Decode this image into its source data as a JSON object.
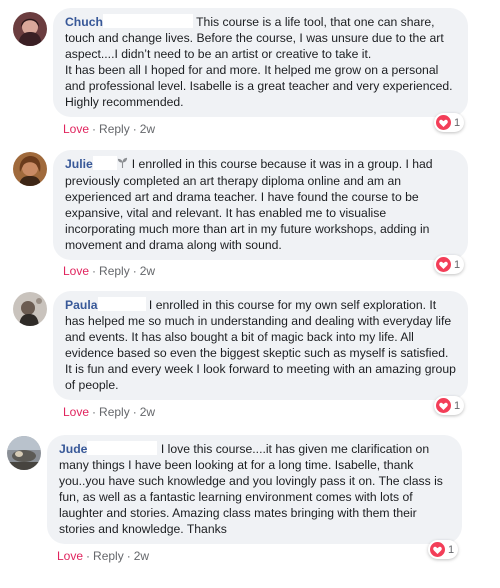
{
  "comments": [
    {
      "author": "Chuch",
      "text": "This course is a life tool, that one can share, touch and change lives. Before the course, I was unsure due to the art aspect....I didn’t need to be an artist or creative to take it.",
      "text2": "It has been all I hoped for and more. It helped me grow on a personal and professional level. Isabelle is a great teacher and very experienced. Highly recommended.",
      "love": "Love",
      "reply": "Reply",
      "time": "2w",
      "reactions": "1"
    },
    {
      "author": "Julie",
      "badge": "sprout-icon",
      "text": "I enrolled in this course because it was in a group. I had previously completed an art therapy diploma online and am an experienced art and drama teacher. I have found the course to be expansive, vital and relevant. It has enabled me to visualise incorporating much more than art in my future workshops, adding in movement and drama along with sound.",
      "love": "Love",
      "reply": "Reply",
      "time": "2w",
      "reactions": "1"
    },
    {
      "author": "Paula",
      "text": "I enrolled in this course for my own self exploration. It has helped me so much in understanding and dealing with everyday life and events. It has also bought a bit of magic back into my life. All evidence based so even the biggest skeptic such as myself is satisfied. It is fun and every week I look forward to meeting with an amazing group of people.",
      "love": "Love",
      "reply": "Reply",
      "time": "2w",
      "reactions": "1"
    },
    {
      "author": "Jude",
      "text": "I love this course....it has given me clarification on many things I have been looking at for a long time. Isabelle, thank you..you have such knowledge and you lovingly pass it on. The class is fun, as well as a fantastic learning environment comes with lots of laughter and stories. Amazing class mates bringing with them their stories and knowledge. Thanks",
      "love": "Love",
      "reply": "Reply",
      "time": "2w",
      "reactions": "1"
    }
  ],
  "colors": {
    "author": "#385898",
    "love": "#e0245e",
    "bubble": "#f0f2f5",
    "heart": "#f33e58"
  }
}
